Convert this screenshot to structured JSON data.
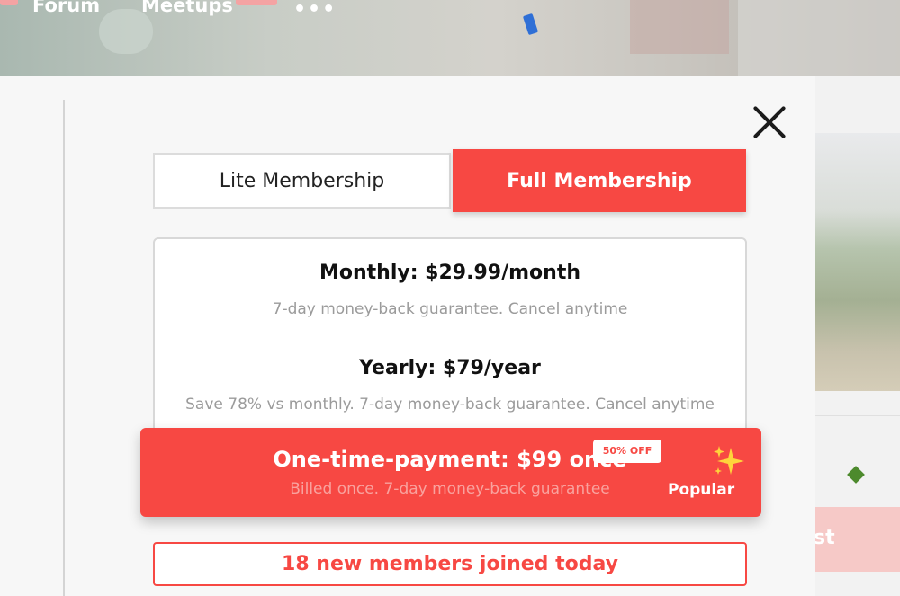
{
  "nav": {
    "forum_label": "Forum",
    "meetups_label": "Meetups",
    "more_label": "•••"
  },
  "background": {
    "right_button_label": "st"
  },
  "modal": {
    "close_icon": "close-icon",
    "tabs": [
      {
        "label": "Lite Membership",
        "selected": false
      },
      {
        "label": "Full Membership",
        "selected": true
      }
    ],
    "plans": {
      "monthly": {
        "title": "Monthly: $29.99/month",
        "subtitle": "7-day money-back guarantee. Cancel anytime"
      },
      "yearly": {
        "title": "Yearly: $79/year",
        "subtitle": "Save 78% vs monthly. 7-day money-back guarantee. Cancel anytime"
      },
      "onetime": {
        "title": "One-time-payment: $99 once",
        "subtitle": "Billed once. 7-day money-back guarantee",
        "badge": "50% OFF",
        "tag": "Popular",
        "tag_icon": "sparkle-icon"
      }
    },
    "social_proof": "18 new members joined today"
  },
  "colors": {
    "accent": "#f74843",
    "sparkle": "#ffd43b"
  }
}
